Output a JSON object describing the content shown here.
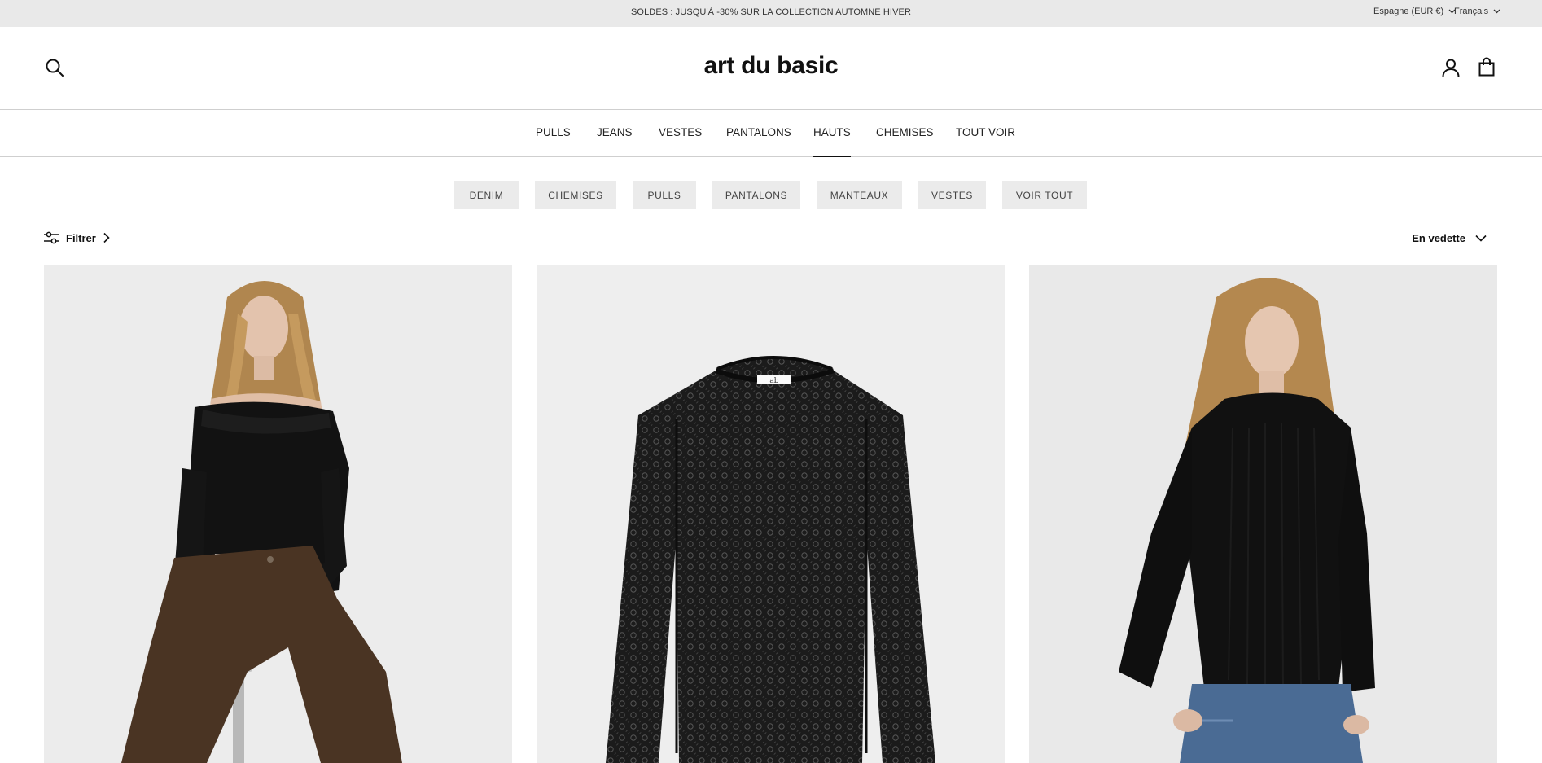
{
  "announcement": {
    "text": "SOLDES : JUSQU'À -30% SUR LA COLLECTION AUTOMNE HIVER",
    "country_selector": "Espagne (EUR €)",
    "language_selector": "Français"
  },
  "header": {
    "logo": "art du basic",
    "icons": [
      "search-icon",
      "account-icon",
      "cart-icon"
    ]
  },
  "nav": {
    "items": [
      "PULLS",
      "JEANS",
      "VESTES",
      "PANTALONS",
      "HAUTS",
      "CHEMISES",
      "TOUT VOIR"
    ],
    "active": "HAUTS"
  },
  "subcategories": [
    "DENIM",
    "CHEMISES",
    "PULLS",
    "PANTALONS",
    "MANTEAUX",
    "VESTES",
    "VOIR TOUT"
  ],
  "toolbar": {
    "filter_label": "Filtrer",
    "sort_label": "En vedette"
  },
  "products": [
    {
      "image": "model-off-shoulder-black-top-brown-trousers"
    },
    {
      "image": "black-lace-long-sleeve-top",
      "label_tag": "ab"
    },
    {
      "image": "model-black-ribbed-sweater-jeans"
    }
  ],
  "colors": {
    "announcement_bg": "#e9e9e9",
    "pill_bg": "#ebebeb",
    "image_bg": "#eeeeee",
    "text": "#111111"
  }
}
